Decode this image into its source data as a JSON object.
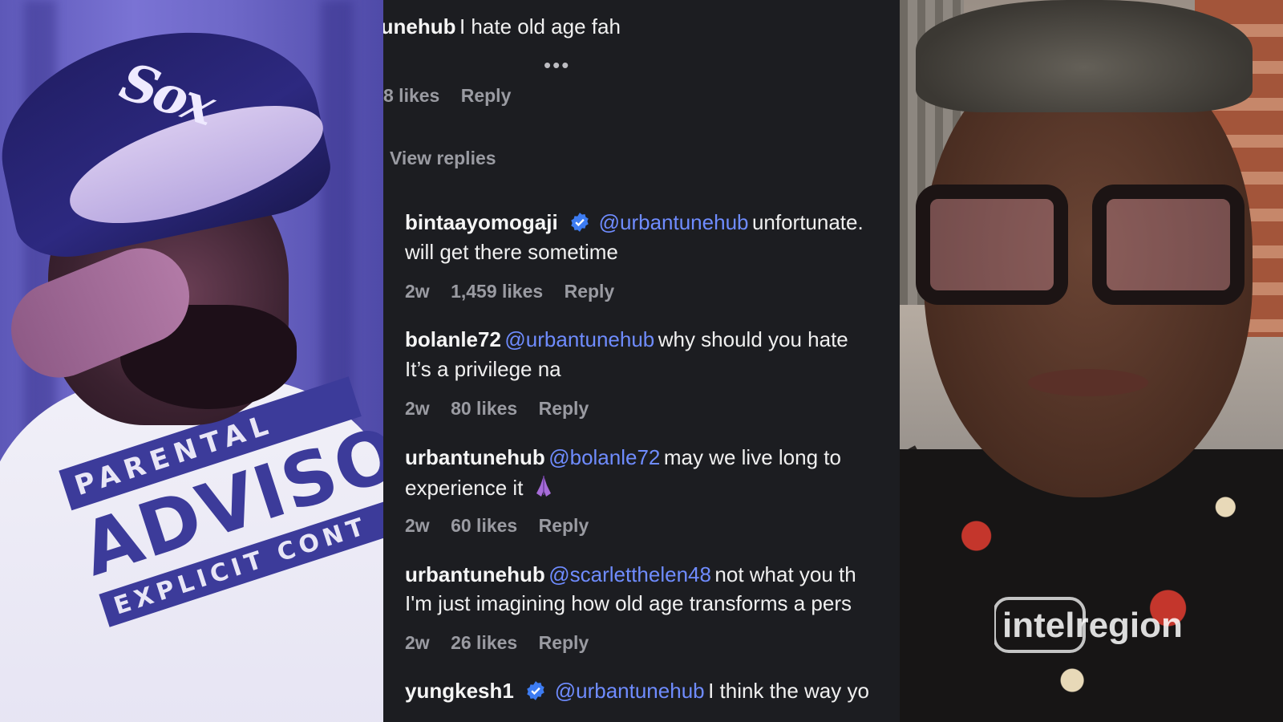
{
  "watermark": {
    "text": "intelregion"
  },
  "left_photo": {
    "cap_logo": "Sox",
    "shirt_text_top": "PARENTAL",
    "shirt_text_main": "ADVISORY",
    "shirt_text_bottom": "EXPLICIT CONT"
  },
  "thread": {
    "top_comment": {
      "username": "tunehub",
      "text": "I hate old age fah"
    },
    "more_indicator": "•••",
    "top_meta": {
      "likes": "8 likes",
      "reply": "Reply"
    },
    "view_replies": "View replies",
    "comments": [
      {
        "username": "bintaayomogaji",
        "verified": true,
        "mention": "@urbantunehub",
        "line1": "unfortunate.",
        "line2": "will get there sometime",
        "time": "2w",
        "likes": "1,459 likes",
        "reply": "Reply"
      },
      {
        "username": "bolanle72",
        "verified": false,
        "mention": "@urbantunehub",
        "line1": "why should you hate",
        "line2": "It’s a privilege na",
        "time": "2w",
        "likes": "80 likes",
        "reply": "Reply"
      },
      {
        "username": "urbantunehub",
        "verified": false,
        "mention": "@bolanle72",
        "line1": "may we live long to",
        "line2": "experience it",
        "emoji": "praying-hands-emoji",
        "time": "2w",
        "likes": "60 likes",
        "reply": "Reply"
      },
      {
        "username": "urbantunehub",
        "verified": false,
        "mention": "@scarletthelen48",
        "line1": "not what you th",
        "line2": "I'm just imagining how old age transforms a pers",
        "time": "2w",
        "likes": "26 likes",
        "reply": "Reply"
      },
      {
        "username": "yungkesh1",
        "verified": true,
        "mention": "@urbantunehub",
        "line1": "I think the way yo"
      }
    ]
  },
  "colors": {
    "panel_bg": "#1c1d21",
    "mention": "#6f8cff",
    "verified": "#3d7cf2",
    "meta": "#9a9ba2"
  }
}
